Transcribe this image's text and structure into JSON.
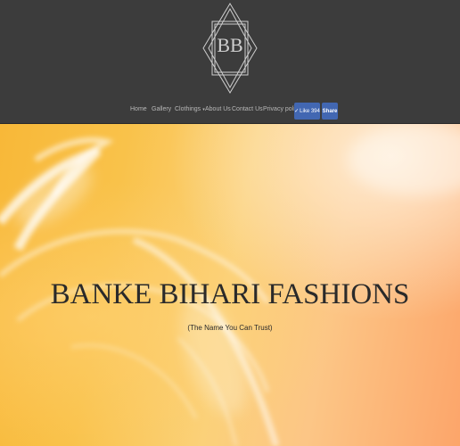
{
  "logo": {
    "text": "BB"
  },
  "nav": {
    "items": [
      {
        "label": "Home"
      },
      {
        "label": "Gallery"
      },
      {
        "label": "Clothings"
      },
      {
        "label": "About Us"
      },
      {
        "label": "Contact Us"
      },
      {
        "label": "Privacy policy"
      }
    ],
    "dropdown_caret": "▾"
  },
  "facebook": {
    "like_label": "Like 394",
    "share_label": "Share",
    "color": "#4267b2"
  },
  "hero": {
    "title": "BANKE BIHARI FASHIONS",
    "subtitle": "(The Name You Can Trust)"
  },
  "colors": {
    "header_bg": "#3c3c3c",
    "nav_text": "#b8b8b8",
    "hero_orange": "#f8b838",
    "hero_peach": "#fca56a"
  }
}
